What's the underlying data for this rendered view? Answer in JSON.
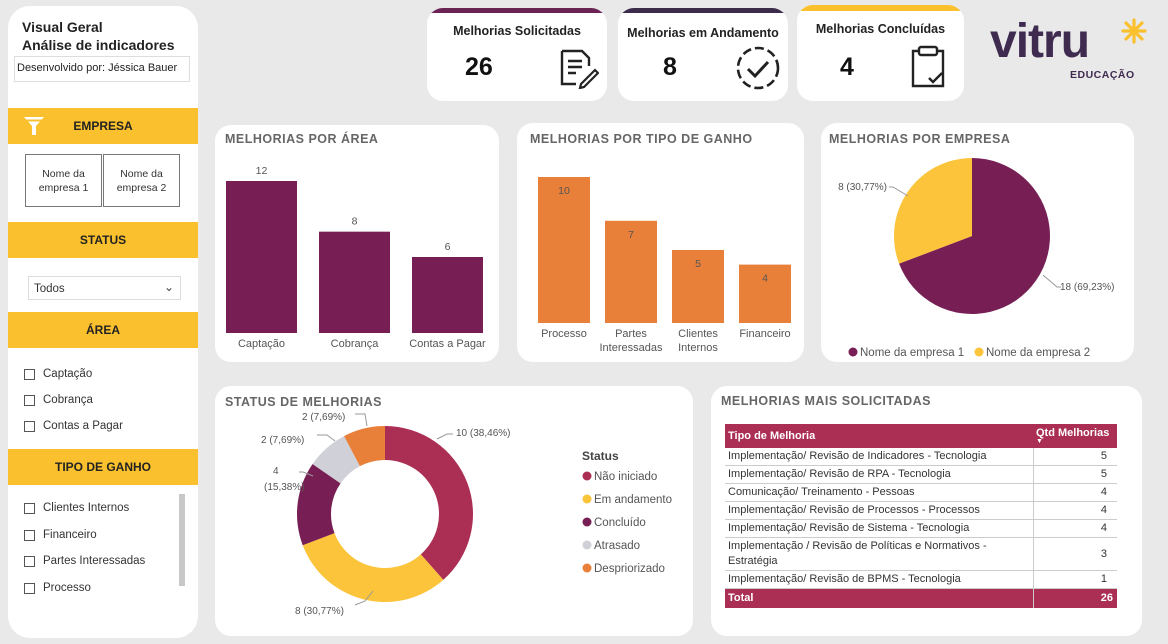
{
  "sidebar": {
    "title_line1": "Visual Geral",
    "title_line2": "Análise de indicadores",
    "developer": "Desenvolvido por: Jéssica Bauer",
    "empresa_header": "EMPRESA",
    "empresas": [
      "Nome da empresa 1",
      "Nome da empresa 2"
    ],
    "status_header": "STATUS",
    "status_selected": "Todos",
    "area_header": "ÁREA",
    "areas": [
      "Captação",
      "Cobrança",
      "Contas a Pagar"
    ],
    "tipo_header": "TIPO DE GANHO",
    "tipos": [
      "Clientes Internos",
      "Financeiro",
      "Partes Interessadas",
      "Processo"
    ]
  },
  "kpis": [
    {
      "title": "Melhorias Solicitadas",
      "value": "26",
      "icon": "document-edit-icon",
      "stripe": "#6b2356"
    },
    {
      "title": "Melhorias em Andamento",
      "value": "8",
      "icon": "progress-check-icon",
      "stripe": "#3c2b4a"
    },
    {
      "title": "Melhorias Concluídas",
      "value": "4",
      "icon": "clipboard-check-icon",
      "stripe": "#fbc02d"
    }
  ],
  "logo": {
    "brand": "vitru",
    "sub": "EDUCAÇÃO"
  },
  "colors": {
    "purple": "#771f54",
    "orange": "#e8803a",
    "yellow": "#fbc43a",
    "crimson": "#ab2e55",
    "gray": "#d0d0d8"
  },
  "chart_data": [
    {
      "type": "bar",
      "title": "MELHORIAS POR ÁREA",
      "categories": [
        "Captação",
        "Cobrança",
        "Contas a Pagar"
      ],
      "values": [
        12,
        8,
        6
      ]
    },
    {
      "type": "bar",
      "title": "MELHORIAS POR TIPO DE GANHO",
      "categories": [
        "Processo",
        "Partes Interessadas",
        "Clientes Internos",
        "Financeiro"
      ],
      "values": [
        10,
        7,
        5,
        4
      ]
    },
    {
      "type": "pie",
      "title": "MELHORIAS POR EMPRESA",
      "categories": [
        "Nome da empresa 1",
        "Nome da empresa 2"
      ],
      "values": [
        18,
        8
      ],
      "labels": [
        "18 (69,23%)",
        "8 (30,77%)"
      ],
      "legend": "bottom"
    },
    {
      "type": "pie",
      "title": "STATUS DE MELHORIAS",
      "legend_title": "Status",
      "categories": [
        "Não iniciado",
        "Em andamento",
        "Concluído",
        "Atrasado",
        "Despriorizado"
      ],
      "values": [
        10,
        8,
        4,
        2,
        2
      ],
      "labels": [
        "10 (38,46%)",
        "8 (30,77%)",
        "4 (15,38%)",
        "2 (7,69%)",
        "2 (7,69%)"
      ],
      "legend": "right"
    },
    {
      "type": "table",
      "title": "MELHORIAS MAIS SOLICITADAS",
      "columns": [
        "Tipo de Melhoria",
        "Qtd Melhorias"
      ],
      "rows": [
        [
          "Implementação/ Revisão de Indicadores - Tecnologia",
          "5"
        ],
        [
          "Implementação/ Revisão de RPA - Tecnologia",
          "5"
        ],
        [
          "Comunicação/ Treinamento - Pessoas",
          "4"
        ],
        [
          "Implementação/ Revisão de Processos - Processos",
          "4"
        ],
        [
          "Implementação/ Revisão de Sistema - Tecnologia",
          "4"
        ],
        [
          "Implementação / Revisão de Políticas e Normativos - Estratégia",
          "3"
        ],
        [
          "Implementação/ Revisão de BPMS - Tecnologia",
          "1"
        ]
      ],
      "total_label": "Total",
      "total_value": "26"
    }
  ]
}
